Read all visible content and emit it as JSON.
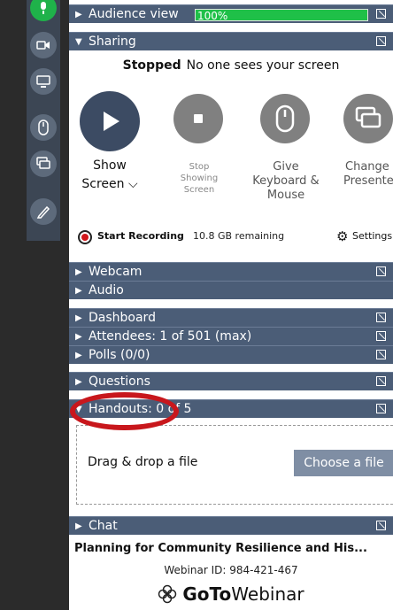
{
  "audience": {
    "label": "Audience view",
    "percent_text": "100%",
    "percent_value": 1.0
  },
  "sharing": {
    "label": "Sharing",
    "status_strong": "Stopped",
    "status_text": "No one sees your screen",
    "show": {
      "line1": "Show",
      "line2": "Screen"
    },
    "stop": {
      "line1": "Stop",
      "line2": "Showing",
      "line3": "Screen"
    },
    "give": {
      "line1": "Give",
      "line2": "Keyboard &",
      "line3": "Mouse"
    },
    "change": {
      "line1": "Change",
      "line2": "Presenter"
    }
  },
  "recording": {
    "label": "Start Recording",
    "remaining": "10.8 GB remaining",
    "settings": "Settings"
  },
  "sections": {
    "webcam": "Webcam",
    "audio": "Audio",
    "dashboard": "Dashboard",
    "attendees": "Attendees: 1 of 501 (max)",
    "polls": "Polls (0/0)",
    "questions": "Questions",
    "handouts": "Handouts: 0 of 5",
    "chat": "Chat"
  },
  "handouts": {
    "drop_text": "Drag & drop a file",
    "choose_label": "Choose a file"
  },
  "webinar": {
    "title": "Planning for Community Resilience and His...",
    "id_text": "Webinar ID: 984-421-467",
    "brand_goto": "GoTo",
    "brand_webinar": "Webinar"
  },
  "colors": {
    "header": "#4b5d77",
    "rail": "#3c4654",
    "mic_green": "#1fb24a",
    "annotation_red": "#c8171c",
    "button_gray": "#5e5e5e"
  }
}
